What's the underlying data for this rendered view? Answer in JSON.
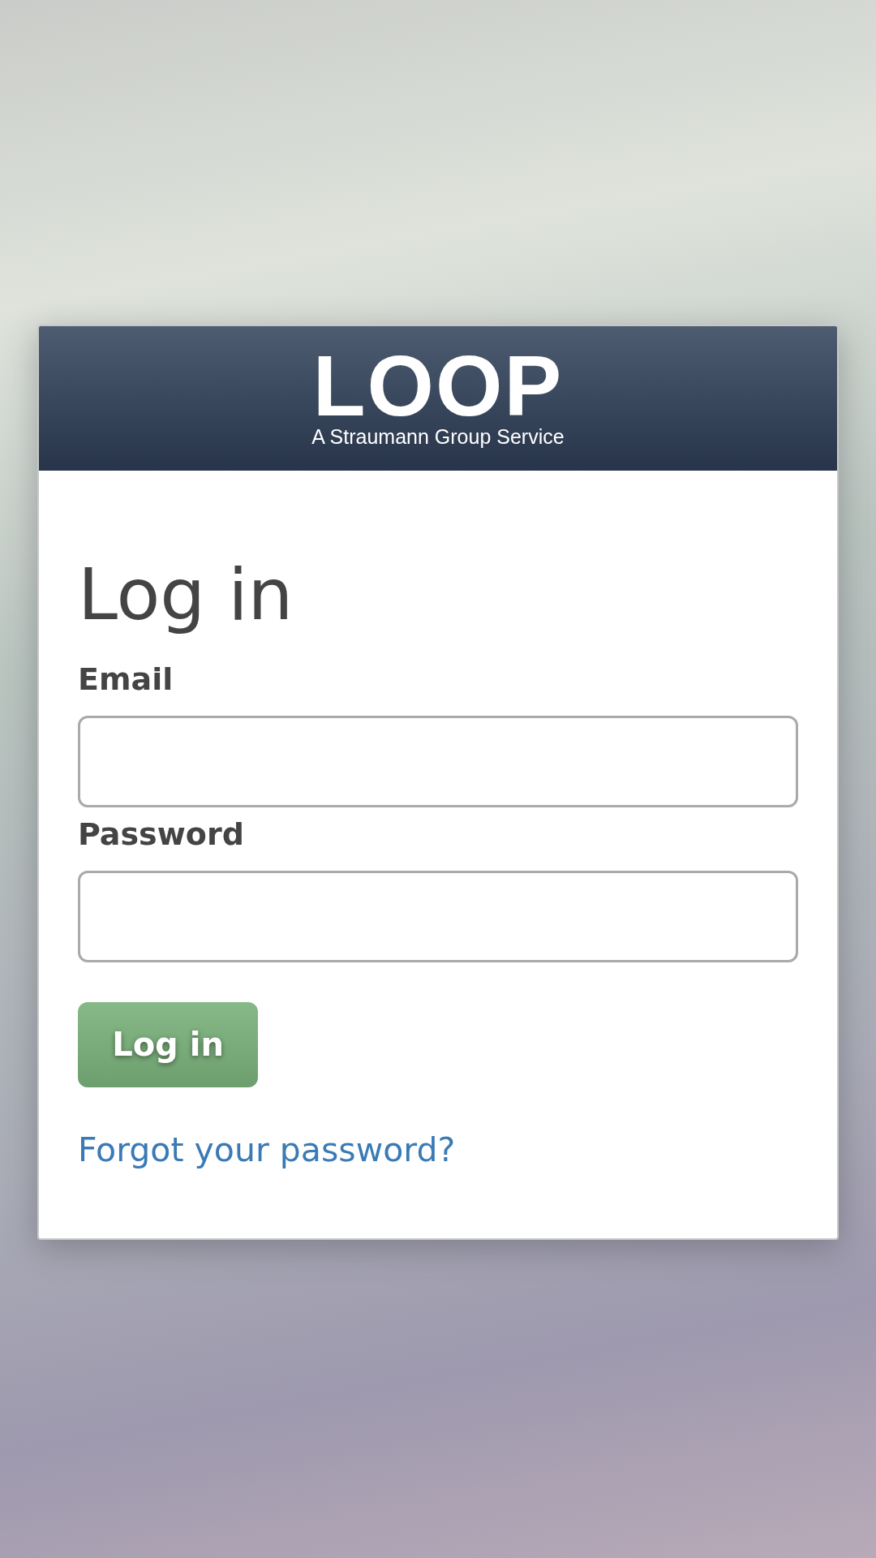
{
  "header": {
    "logo": "LOOP",
    "tagline": "A Straumann Group Service"
  },
  "title": "Log in",
  "fields": [
    {
      "label": "Email"
    },
    {
      "label": "Password"
    }
  ],
  "button": "Log in",
  "link": "Forgot your password?"
}
